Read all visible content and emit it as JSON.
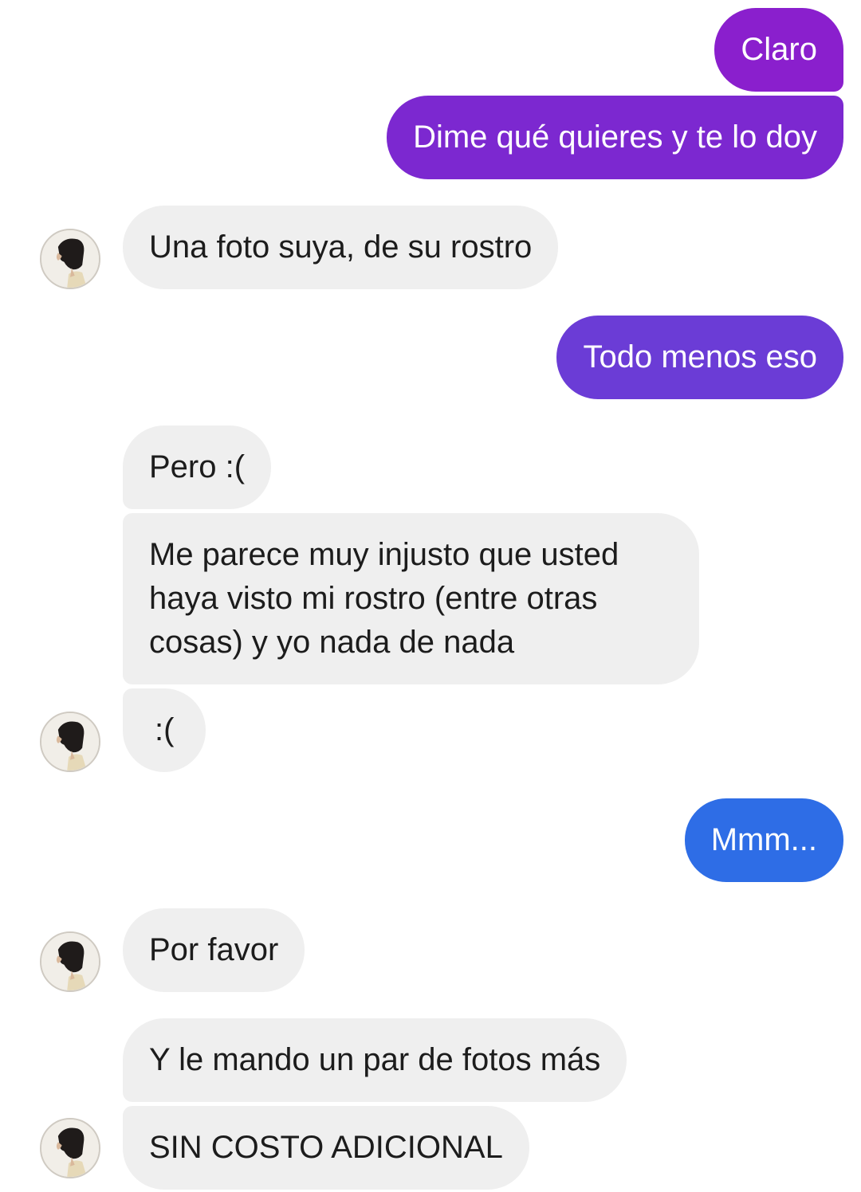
{
  "contact": {
    "avatar_icon": "profile-photo-avatar-icon"
  },
  "colors": {
    "outgoing_purple": "#8a1fcd",
    "outgoing_mid": "#6b3cd6",
    "outgoing_blue": "#2e6de6",
    "incoming_bg": "#efefef",
    "incoming_text": "#1c1c1c"
  },
  "messages": [
    {
      "direction": "outgoing",
      "text": "Claro"
    },
    {
      "direction": "outgoing",
      "text": "Dime qué quieres y te lo doy"
    },
    {
      "direction": "incoming",
      "text": "Una foto suya, de su rostro"
    },
    {
      "direction": "outgoing",
      "text": "Todo menos eso"
    },
    {
      "direction": "incoming",
      "text": "Pero :("
    },
    {
      "direction": "incoming",
      "text": "Me parece muy injusto que usted haya visto mi rostro (entre otras cosas) y yo nada de nada"
    },
    {
      "direction": "incoming",
      "text": ":("
    },
    {
      "direction": "outgoing",
      "text": "Mmm..."
    },
    {
      "direction": "incoming",
      "text": "Por favor"
    },
    {
      "direction": "incoming",
      "text": "Y le mando un par de fotos más"
    },
    {
      "direction": "incoming",
      "text": "SIN COSTO ADICIONAL"
    }
  ]
}
